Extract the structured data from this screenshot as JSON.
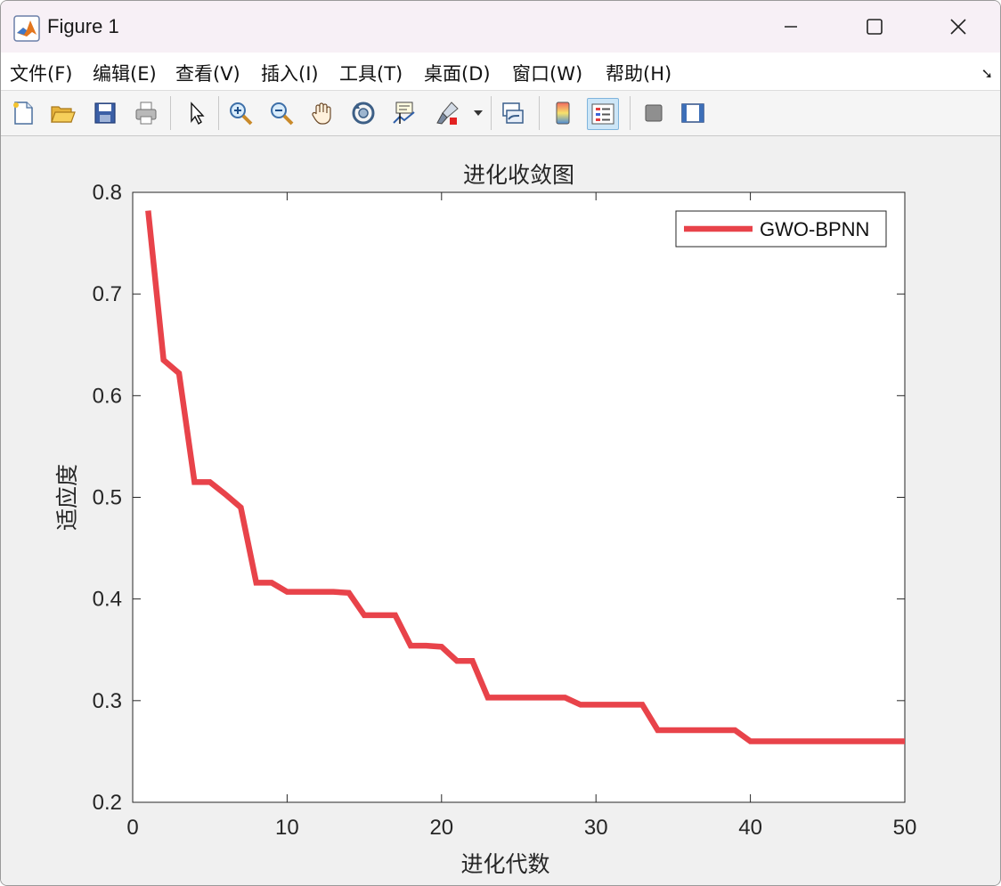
{
  "window": {
    "title": "Figure 1"
  },
  "menu": [
    "文件(F)",
    "编辑(E)",
    "查看(V)",
    "插入(I)",
    "工具(T)",
    "桌面(D)",
    "窗口(W)",
    "帮助(H)"
  ],
  "toolbar_icons": [
    "new-figure-icon",
    "open-file-icon",
    "save-icon",
    "print-icon",
    "select-arrow-icon",
    "zoom-in-icon",
    "zoom-out-icon",
    "pan-hand-icon",
    "rotate-3d-icon",
    "data-cursor-icon",
    "brush-icon",
    "link-plot-icon",
    "colorbar-icon",
    "legend-icon",
    "hide-plot-tools-icon",
    "show-plot-tools-icon"
  ],
  "chart_data": {
    "type": "line",
    "title": "进化收敛图",
    "xlabel": "进化代数",
    "ylabel": "适应度",
    "xlim": [
      0,
      50
    ],
    "ylim": [
      0.2,
      0.8
    ],
    "xticks": [
      "0",
      "10",
      "20",
      "30",
      "40",
      "50"
    ],
    "yticks": [
      "0.2",
      "0.3",
      "0.4",
      "0.5",
      "0.6",
      "0.7",
      "0.8"
    ],
    "legend_position": "top-right",
    "series": [
      {
        "name": "GWO-BPNN",
        "color": "#e8434a",
        "x": [
          1,
          2,
          3,
          4,
          5,
          6,
          7,
          8,
          9,
          10,
          11,
          12,
          13,
          14,
          15,
          16,
          17,
          18,
          19,
          20,
          21,
          22,
          23,
          24,
          25,
          26,
          27,
          28,
          29,
          30,
          31,
          32,
          33,
          34,
          35,
          36,
          37,
          38,
          39,
          40,
          41,
          42,
          43,
          44,
          45,
          46,
          47,
          48,
          49,
          50
        ],
        "y": [
          0.782,
          0.635,
          0.622,
          0.515,
          0.515,
          0.503,
          0.49,
          0.416,
          0.416,
          0.407,
          0.407,
          0.407,
          0.407,
          0.406,
          0.384,
          0.384,
          0.384,
          0.354,
          0.354,
          0.353,
          0.339,
          0.339,
          0.303,
          0.303,
          0.303,
          0.303,
          0.303,
          0.303,
          0.296,
          0.296,
          0.296,
          0.296,
          0.296,
          0.271,
          0.271,
          0.271,
          0.271,
          0.271,
          0.271,
          0.26,
          0.26,
          0.26,
          0.26,
          0.26,
          0.26,
          0.26,
          0.26,
          0.26,
          0.26,
          0.26
        ]
      }
    ]
  }
}
